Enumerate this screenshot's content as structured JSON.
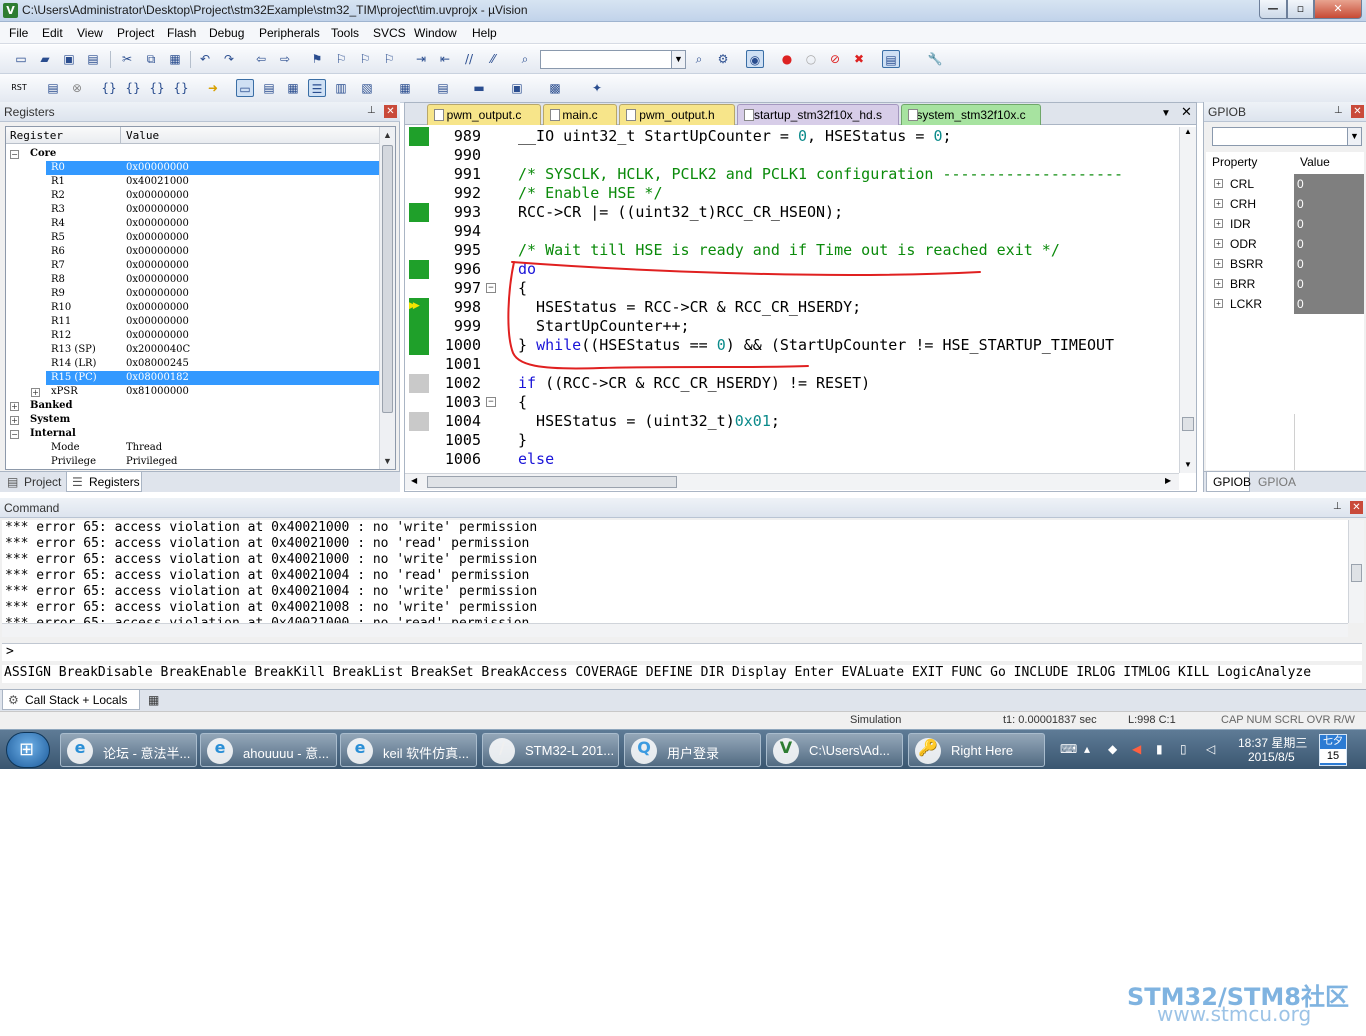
{
  "window": {
    "title": "C:\\Users\\Administrator\\Desktop\\Project\\stm32Example\\stm32_TIM\\project\\tim.uvprojx - µVision",
    "icon_label": "V",
    "minimize": "—",
    "maximize": "▫",
    "close": "✕"
  },
  "menu": [
    "File",
    "Edit",
    "View",
    "Project",
    "Flash",
    "Debug",
    "Peripherals",
    "Tools",
    "SVCS",
    "Window",
    "Help"
  ],
  "toolbar": {
    "rst_label": "RST"
  },
  "registers_pane": {
    "title": "Registers",
    "col_register": "Register",
    "col_value": "Value",
    "rows": [
      {
        "name": "Core",
        "value": "",
        "type": "group",
        "expander": "−"
      },
      {
        "name": "R0",
        "value": "0x00000000",
        "type": "reg",
        "selected": true
      },
      {
        "name": "R1",
        "value": "0x40021000",
        "type": "reg"
      },
      {
        "name": "R2",
        "value": "0x00000000",
        "type": "reg"
      },
      {
        "name": "R3",
        "value": "0x00000000",
        "type": "reg"
      },
      {
        "name": "R4",
        "value": "0x00000000",
        "type": "reg"
      },
      {
        "name": "R5",
        "value": "0x00000000",
        "type": "reg"
      },
      {
        "name": "R6",
        "value": "0x00000000",
        "type": "reg"
      },
      {
        "name": "R7",
        "value": "0x00000000",
        "type": "reg"
      },
      {
        "name": "R8",
        "value": "0x00000000",
        "type": "reg"
      },
      {
        "name": "R9",
        "value": "0x00000000",
        "type": "reg"
      },
      {
        "name": "R10",
        "value": "0x00000000",
        "type": "reg"
      },
      {
        "name": "R11",
        "value": "0x00000000",
        "type": "reg"
      },
      {
        "name": "R12",
        "value": "0x00000000",
        "type": "reg"
      },
      {
        "name": "R13 (SP)",
        "value": "0x2000040C",
        "type": "reg"
      },
      {
        "name": "R14 (LR)",
        "value": "0x08000245",
        "type": "reg"
      },
      {
        "name": "R15 (PC)",
        "value": "0x08000182",
        "type": "reg",
        "selected": true
      },
      {
        "name": "xPSR",
        "value": "0x81000000",
        "type": "subgroup",
        "expander": "+"
      },
      {
        "name": "Banked",
        "value": "",
        "type": "group",
        "expander": "+"
      },
      {
        "name": "System",
        "value": "",
        "type": "group",
        "expander": "+"
      },
      {
        "name": "Internal",
        "value": "",
        "type": "group",
        "expander": "−"
      },
      {
        "name": "Mode",
        "value": "Thread",
        "type": "reg"
      },
      {
        "name": "Privilege",
        "value": "Privileged",
        "type": "reg"
      }
    ],
    "tabs": [
      "Project",
      "Registers"
    ]
  },
  "editor": {
    "tabs": [
      {
        "label": "pwm_output.c",
        "style": "yellow"
      },
      {
        "label": "main.c",
        "style": "yellow"
      },
      {
        "label": "pwm_output.h",
        "style": "yellow"
      },
      {
        "label": "startup_stm32f10x_hd.s",
        "style": "purple"
      },
      {
        "label": "system_stm32f10x.c",
        "style": "active"
      }
    ],
    "close_symbol": "✕",
    "dropdown_symbol": "▼",
    "lines": [
      {
        "num": "989",
        "mark": "green",
        "fold": "",
        "code": [
          [
            "",
            "__IO uint32_t StartUpCounter = "
          ],
          [
            "num",
            "0"
          ],
          [
            "",
            ", HSEStatus = "
          ],
          [
            "num",
            "0"
          ],
          [
            "",
            ";"
          ]
        ]
      },
      {
        "num": "990",
        "mark": "",
        "fold": "",
        "code": []
      },
      {
        "num": "991",
        "mark": "",
        "fold": "",
        "code": [
          [
            "cm",
            "/* SYSCLK, HCLK, PCLK2 and PCLK1 configuration --------------------"
          ]
        ]
      },
      {
        "num": "992",
        "mark": "",
        "fold": "",
        "code": [
          [
            "cm",
            "/* Enable HSE */"
          ]
        ]
      },
      {
        "num": "993",
        "mark": "green",
        "fold": "",
        "code": [
          [
            "",
            "RCC->CR |= ((uint32_t)RCC_CR_HSEON);"
          ]
        ]
      },
      {
        "num": "994",
        "mark": "",
        "fold": "",
        "code": []
      },
      {
        "num": "995",
        "mark": "",
        "fold": "",
        "code": [
          [
            "cm",
            "/* Wait till HSE is ready and if Time out is reached exit */"
          ]
        ]
      },
      {
        "num": "996",
        "mark": "green",
        "fold": "",
        "code": [
          [
            "kw",
            "do"
          ]
        ]
      },
      {
        "num": "997",
        "mark": "",
        "fold": "−",
        "code": [
          [
            "",
            "{"
          ]
        ]
      },
      {
        "num": "998",
        "mark": "arrow",
        "fold": "",
        "code": [
          [
            "",
            "  HSEStatus = RCC->CR & RCC_CR_HSERDY;"
          ]
        ]
      },
      {
        "num": "999",
        "mark": "green",
        "fold": "",
        "code": [
          [
            "",
            "  StartUpCounter++;"
          ]
        ]
      },
      {
        "num": "1000",
        "mark": "green",
        "fold": "",
        "code": [
          [
            "",
            "} "
          ],
          [
            "kw",
            "while"
          ],
          [
            "",
            "((HSEStatus == "
          ],
          [
            "num",
            "0"
          ],
          [
            "",
            ") && (StartUpCounter != HSE_STARTUP_TIMEOUT"
          ]
        ]
      },
      {
        "num": "1001",
        "mark": "",
        "fold": "",
        "code": []
      },
      {
        "num": "1002",
        "mark": "gray",
        "fold": "",
        "code": [
          [
            "kw",
            "if"
          ],
          [
            "",
            " ((RCC->CR & RCC_CR_HSERDY) != RESET)"
          ]
        ]
      },
      {
        "num": "1003",
        "mark": "",
        "fold": "−",
        "code": [
          [
            "",
            "{"
          ]
        ]
      },
      {
        "num": "1004",
        "mark": "gray",
        "fold": "",
        "code": [
          [
            "",
            "  HSEStatus = (uint32_t)"
          ],
          [
            "num",
            "0x01"
          ],
          [
            "",
            ";"
          ]
        ]
      },
      {
        "num": "1005",
        "mark": "",
        "fold": "",
        "code": [
          [
            "",
            "}"
          ]
        ]
      },
      {
        "num": "1006",
        "mark": "",
        "fold": "",
        "code": [
          [
            "kw",
            "else"
          ]
        ]
      }
    ]
  },
  "gpio_pane": {
    "title": "GPIOB",
    "col_property": "Property",
    "col_value": "Value",
    "rows": [
      {
        "name": "CRL",
        "value": "0"
      },
      {
        "name": "CRH",
        "value": "0"
      },
      {
        "name": "IDR",
        "value": "0"
      },
      {
        "name": "ODR",
        "value": "0"
      },
      {
        "name": "BSRR",
        "value": "0"
      },
      {
        "name": "BRR",
        "value": "0"
      },
      {
        "name": "LCKR",
        "value": "0"
      }
    ],
    "tabs": [
      "GPIOB",
      "GPIOA"
    ]
  },
  "command": {
    "title": "Command",
    "output": [
      "*** error 65: access violation at 0x40021000 : no 'write' permission",
      "*** error 65: access violation at 0x40021000 : no 'read' permission",
      "*** error 65: access violation at 0x40021000 : no 'write' permission",
      "*** error 65: access violation at 0x40021004 : no 'read' permission",
      "*** error 65: access violation at 0x40021004 : no 'write' permission",
      "*** error 65: access violation at 0x40021008 : no 'write' permission",
      "*** error 65: access violation at 0x40021000 : no 'read' permission"
    ],
    "prompt": ">",
    "keywords": "ASSIGN BreakDisable BreakEnable BreakKill BreakList BreakSet BreakAccess COVERAGE DEFINE DIR Display Enter EVALuate EXIT FUNC Go INCLUDE IRLOG ITMLOG KILL LogicAnalyze"
  },
  "callstack_tab": "Call Stack + Locals",
  "status": {
    "mode": "Simulation",
    "time": "t1: 0.00001837 sec",
    "position": "L:998 C:1",
    "flags": "CAP  NUM  SCRL  OVR  R/W"
  },
  "taskbar": {
    "items": [
      {
        "label": "论坛 - 意法半...",
        "icon": "e",
        "color": "#2a8fd6"
      },
      {
        "label": "ahouuuu - 意...",
        "icon": "e",
        "color": "#2a8fd6"
      },
      {
        "label": "keil 软件仿真...",
        "icon": "e",
        "color": "#2a8fd6"
      },
      {
        "label": "STM32-L 201...",
        "icon": "/",
        "color": "#f0f0f0"
      },
      {
        "label": "用户登录",
        "icon": "Q",
        "color": "#3c9be0"
      },
      {
        "label": "C:\\Users\\Ad...",
        "icon": "V",
        "color": "#2e7d32"
      },
      {
        "label": "Right Here",
        "icon": "🔑",
        "color": "#e0a030"
      }
    ],
    "clock_time": "18:37 星期三",
    "clock_date": "2015/8/5",
    "cal_top": "七夕",
    "cal_day": "15"
  },
  "watermark": {
    "line1": "STM32/STM8社区",
    "line2": "www.stmcu.org"
  },
  "colors": {
    "breakpoint_green": "#1fa02a",
    "annotation_red": "#e02020",
    "keyword_blue": "#1a14d8",
    "comment_green": "#0a8a0a"
  }
}
